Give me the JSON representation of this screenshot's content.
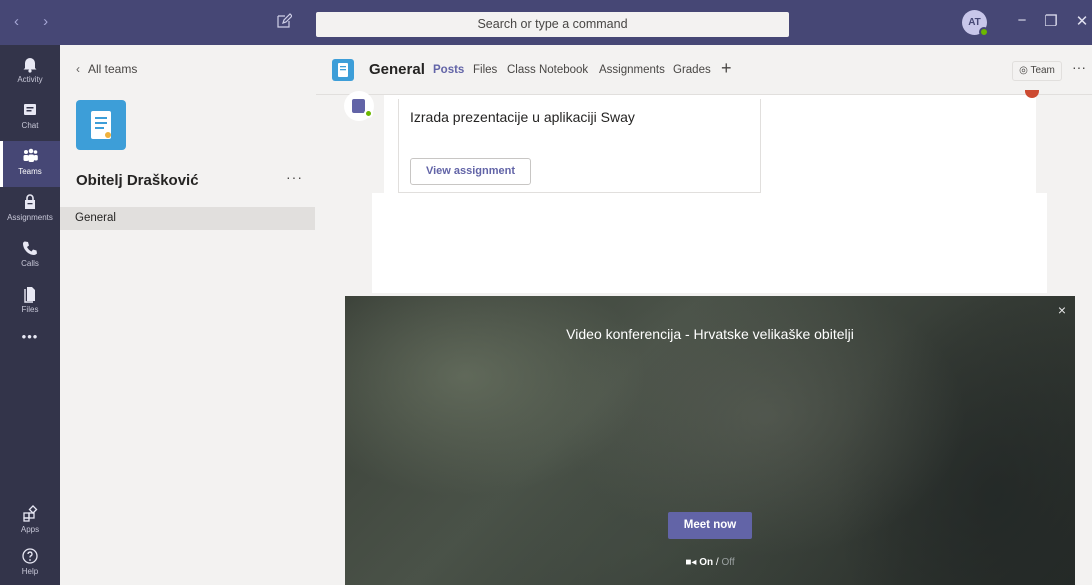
{
  "titlebar": {
    "back_forward": "‹ ›",
    "search_placeholder": "Search or type a command",
    "avatar_initials": "AT",
    "minimize": "−",
    "maximize": "❐",
    "close": "✕"
  },
  "rail": {
    "items": [
      {
        "label": "Activity",
        "icon": "bell-icon"
      },
      {
        "label": "Chat",
        "icon": "chat-icon"
      },
      {
        "label": "Teams",
        "icon": "teams-icon"
      },
      {
        "label": "Assignments",
        "icon": "assignments-icon"
      },
      {
        "label": "Calls",
        "icon": "phone-icon"
      },
      {
        "label": "Files",
        "icon": "file-icon"
      }
    ],
    "more": "•••",
    "apps": "Apps",
    "help": "Help"
  },
  "sidebar": {
    "back_label": "All teams",
    "team_name": "Obitelj Drašković",
    "team_more": "···",
    "channels": [
      "General"
    ]
  },
  "header": {
    "channel_title": "General",
    "tabs": [
      "Posts",
      "Files",
      "Class Notebook",
      "Assignments",
      "Grades"
    ],
    "add_tab": "+",
    "team_button": "Team",
    "more": "···"
  },
  "post": {
    "assignment_title": "Izrada prezentacije u aplikaciji Sway",
    "view_button": "View assignment"
  },
  "meeting": {
    "close": "×",
    "title": "Video konferencija - Hrvatske velikaške obitelji",
    "meet_now": "Meet now",
    "camera_on": "On",
    "camera_sep": "/",
    "camera_off": "Off"
  },
  "colors": {
    "titlebar": "#464775",
    "rail": "#33344a",
    "accent": "#6264a7",
    "status_green": "#6bb700"
  }
}
